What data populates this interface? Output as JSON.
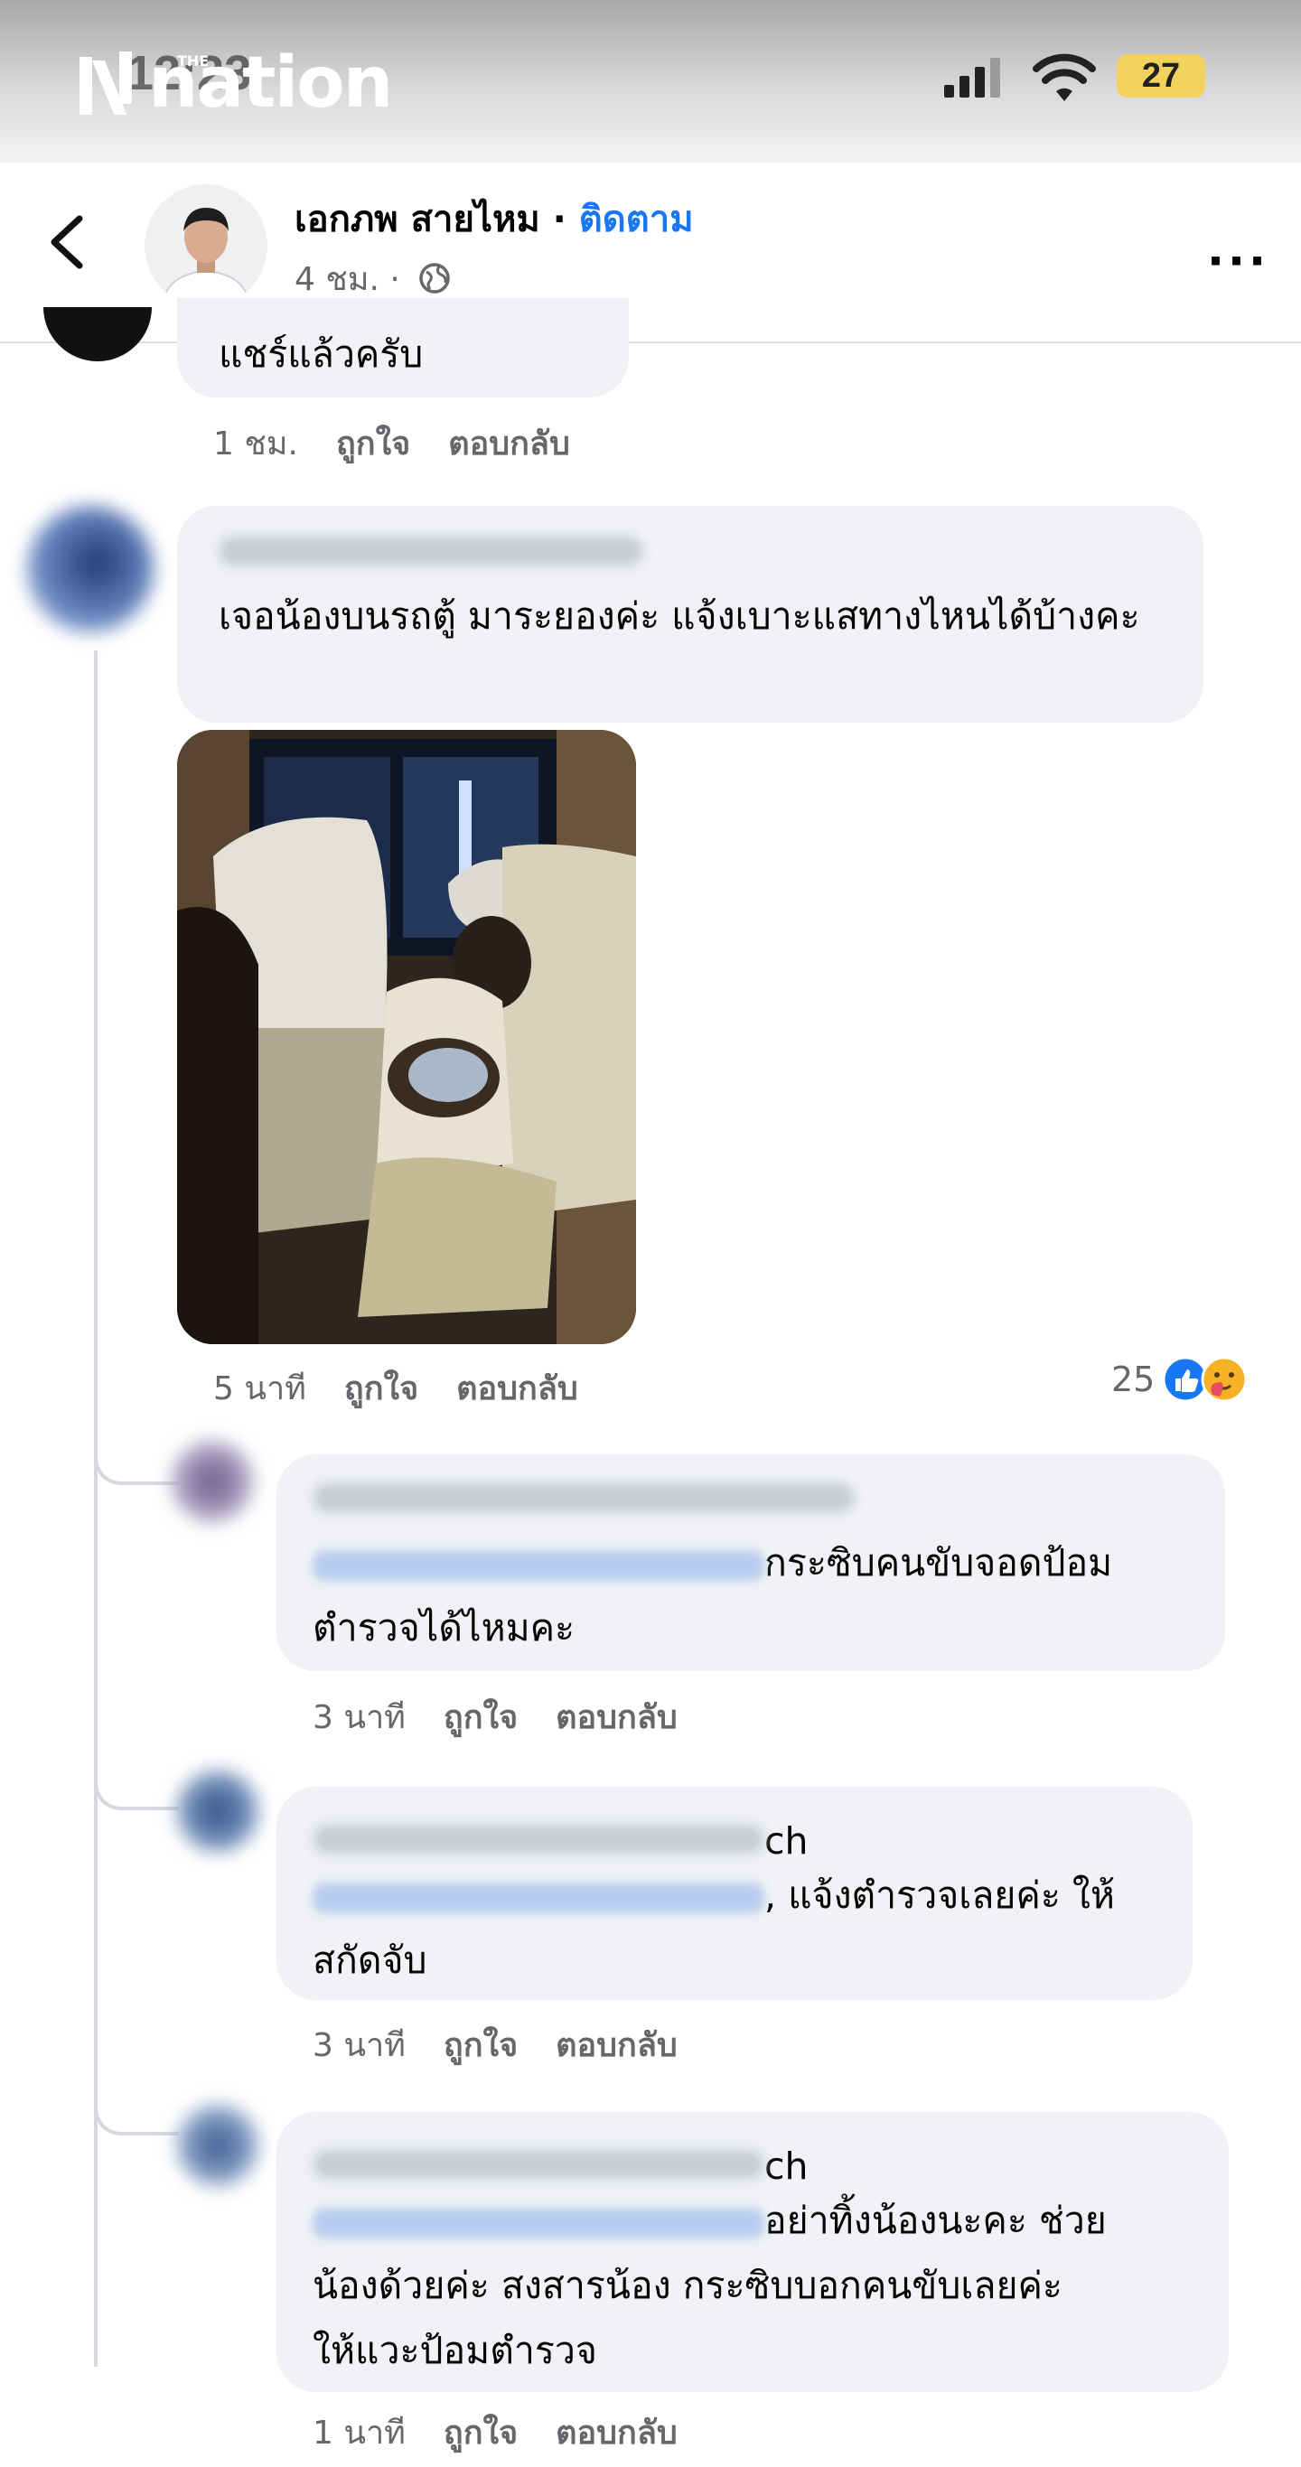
{
  "status_bar": {
    "logo_small": "THE",
    "logo": "nation",
    "time": "12:23",
    "battery": "27"
  },
  "header": {
    "author": "เอกภพ สายไหม",
    "separator": " · ",
    "follow": "ติดตาม",
    "time": "4 ชม. ·"
  },
  "comments": [
    {
      "text": "แชร์แล้วครับ",
      "time": "1 ชม.",
      "like": "ถูกใจ",
      "reply": "ตอบกลับ"
    },
    {
      "text": "เจอน้องบนรถตู้ มาระยองค่ะ แจ้งเบาะแสทางไหนได้บ้างคะ",
      "time": "5 นาที",
      "like": "ถูกใจ",
      "reply": "ตอบกลับ",
      "reactions": "25"
    },
    {
      "text_after_tag": "กระซิบคนขับจอดป้อม",
      "text_line2": "ตำรวจได้ไหมคะ",
      "time": "3 นาที",
      "like": "ถูกใจ",
      "reply": "ตอบกลับ"
    },
    {
      "name_suffix": "ch",
      "text_after_tag": ", แจ้งตำรวจเลยค่ะ ให้",
      "text_line2": "สกัดจับ",
      "time": "3 นาที",
      "like": "ถูกใจ",
      "reply": "ตอบกลับ"
    },
    {
      "name_suffix": "ch",
      "text_after_tag": "อย่าทิ้งน้องนะคะ ช่วย",
      "text_line2": "น้องด้วยค่ะ สงสารน้อง กระซิบบอกคนขับเลยค่ะ",
      "text_line3": "ให้แวะป้อมตำรวจ",
      "time": "1 นาที",
      "like": "ถูกใจ",
      "reply": "ตอบกลับ"
    }
  ],
  "colors": {
    "accent": "#1877f2",
    "bubble": "#f0f2f5",
    "meta_text": "#65676b"
  }
}
